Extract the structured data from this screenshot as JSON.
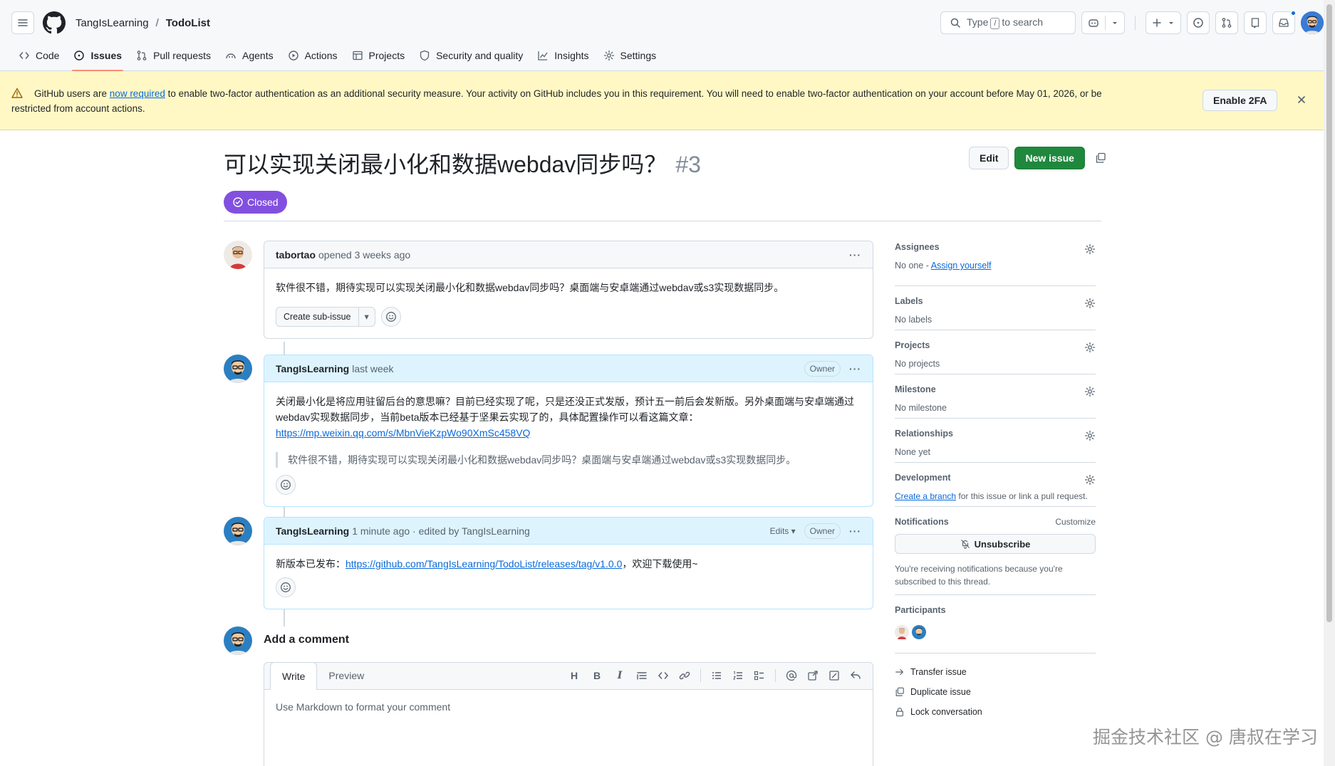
{
  "header": {
    "owner": "TangIsLearning",
    "separator": "/",
    "repo": "TodoList",
    "search_prefix": "Type",
    "search_key": "/",
    "search_suffix": "to search"
  },
  "nav": [
    {
      "label": "Code",
      "icon": "code-icon"
    },
    {
      "label": "Issues",
      "icon": "issue-opened-icon",
      "active": true
    },
    {
      "label": "Pull requests",
      "icon": "git-pull-request-icon"
    },
    {
      "label": "Agents",
      "icon": "agent-icon"
    },
    {
      "label": "Actions",
      "icon": "play-icon"
    },
    {
      "label": "Projects",
      "icon": "table-icon"
    },
    {
      "label": "Security and quality",
      "icon": "shield-icon"
    },
    {
      "label": "Insights",
      "icon": "graph-icon"
    },
    {
      "label": "Settings",
      "icon": "gear-icon"
    }
  ],
  "banner": {
    "text_before": "GitHub users are ",
    "link": "now required",
    "text_after": " to enable two-factor authentication as an additional security measure. Your activity on GitHub includes you in this requirement. You will need to enable two-factor authentication on your account before May 01, 2026, or be",
    "line2": "restricted from account actions.",
    "button": "Enable 2FA"
  },
  "issue": {
    "title": "可以实现关闭最小化和数据webdav同步吗？",
    "number": "#3",
    "state": "Closed",
    "edit_label": "Edit",
    "new_issue_label": "New issue"
  },
  "comments": [
    {
      "author": "tabortao",
      "meta": "opened 3 weeks ago",
      "body": "软件很不错，期待实现可以实现关闭最小化和数据webdav同步吗？桌面端与安卓端通过webdav或s3实现数据同步。",
      "sub_issue_label": "Create sub-issue"
    },
    {
      "author": "TangIsLearning",
      "meta": "last week",
      "badge": "Owner",
      "body_line1": "关闭最小化是将应用驻留后台的意思嘛？目前已经实现了呢，只是还没正式发版，预计五一前后会发新版。另外桌面端与安卓端通过",
      "body_line2": "webdav实现数据同步，当前beta版本已经基于坚果云实现了的，具体配置操作可以看这篇文章：",
      "link": "https://mp.weixin.qq.com/s/MbnVieKzpWo90XmSc458VQ",
      "quote": "软件很不错，期待实现可以实现关闭最小化和数据webdav同步吗？桌面端与安卓端通过webdav或s3实现数据同步。"
    },
    {
      "author": "TangIsLearning",
      "meta": "1 minute ago · edited by TangIsLearning",
      "edits_label": "Edits",
      "badge": "Owner",
      "body_prefix": "新版本已发布：",
      "link": "https://github.com/TangIsLearning/TodoList/releases/tag/v1.0.0",
      "body_suffix": "，欢迎下载使用~"
    }
  ],
  "add_comment": {
    "title": "Add a comment",
    "tab_write": "Write",
    "tab_preview": "Preview",
    "placeholder": "Use Markdown to format your comment"
  },
  "sidebar": {
    "assignees": {
      "heading": "Assignees",
      "value_prefix": "No one - ",
      "link": "Assign yourself"
    },
    "labels": {
      "heading": "Labels",
      "value": "No labels"
    },
    "projects": {
      "heading": "Projects",
      "value": "No projects"
    },
    "milestone": {
      "heading": "Milestone",
      "value": "No milestone"
    },
    "relationships": {
      "heading": "Relationships",
      "value": "None yet"
    },
    "development": {
      "heading": "Development",
      "link": "Create a branch",
      "value_suffix": " for this issue or link a pull request."
    },
    "notifications": {
      "heading": "Notifications",
      "customize": "Customize",
      "button": "Unsubscribe",
      "note": "You're receiving notifications because you're subscribed to this thread."
    },
    "participants": {
      "heading": "Participants"
    },
    "actions": [
      {
        "label": "Transfer issue",
        "icon": "arrow-right-icon"
      },
      {
        "label": "Duplicate issue",
        "icon": "duplicate-icon"
      },
      {
        "label": "Lock conversation",
        "icon": "lock-icon"
      }
    ]
  },
  "watermark": "掘金技术社区 @ 唐叔在学习",
  "colors": {
    "closed": "#8250df",
    "primary": "#1f883d",
    "link": "#0969da",
    "banner": "#fff8c5"
  }
}
